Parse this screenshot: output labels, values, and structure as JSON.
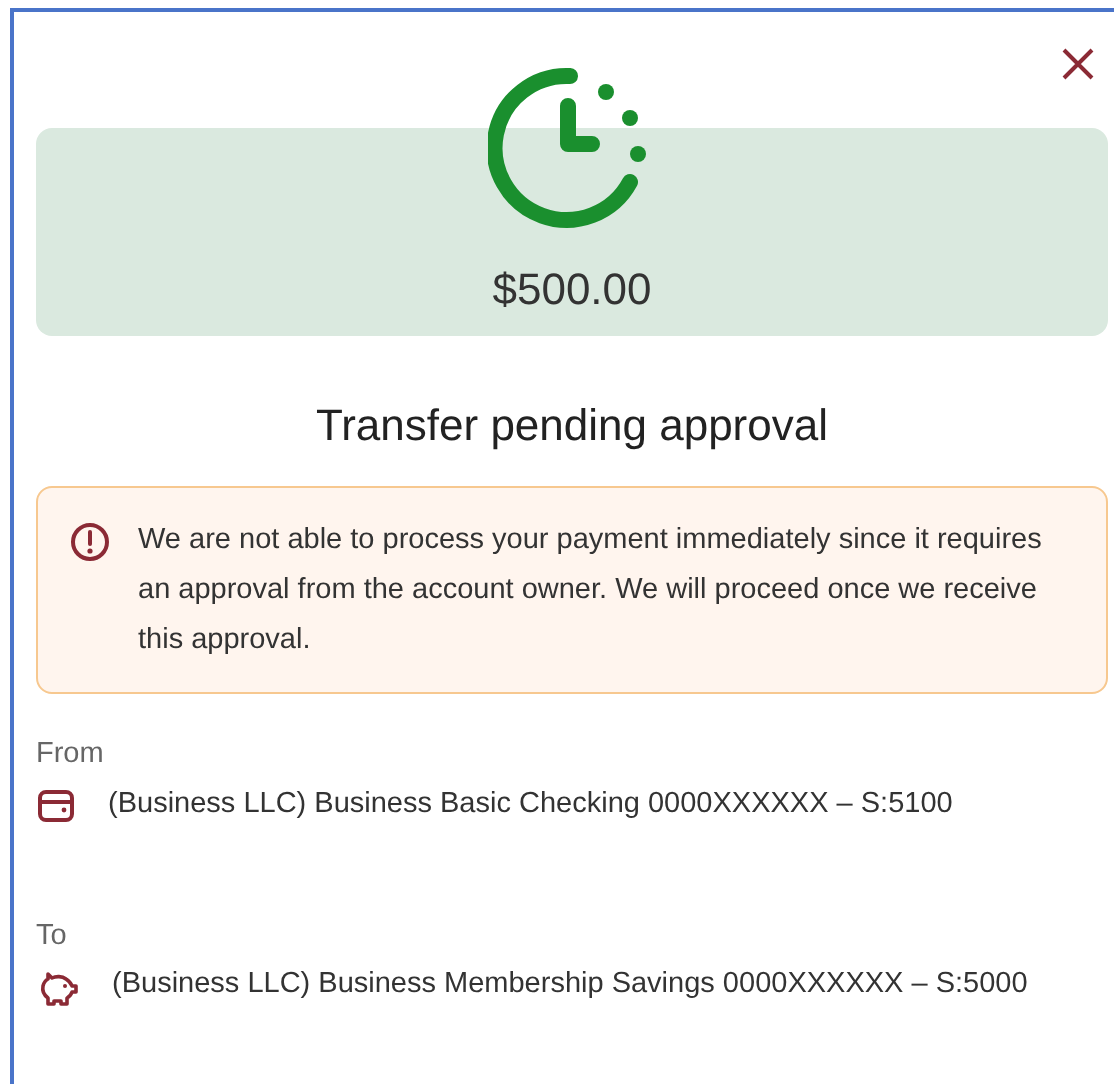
{
  "amount": "$500.00",
  "title": "Transfer pending approval",
  "alert": {
    "message": "We are not able to process your payment immediately since it requires an approval from the account owner. We will proceed once we receive this approval."
  },
  "accounts": [
    {
      "label": "From",
      "kind": "wallet",
      "name": "(Business LLC) Business Basic Checking 0000XXXXXX – S:5100"
    },
    {
      "label": "To",
      "kind": "piggy",
      "name": "(Business LLC) Business Membership Savings 0000XXXXXX – S:5000"
    }
  ]
}
